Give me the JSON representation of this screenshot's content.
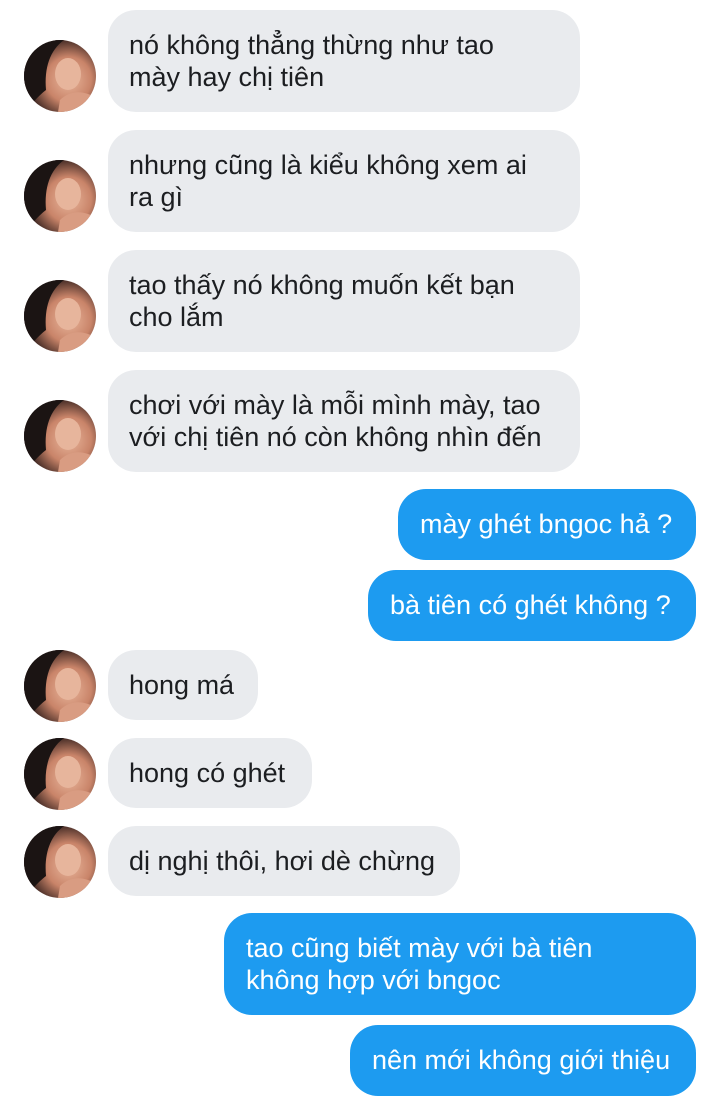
{
  "messages": [
    {
      "direction": "received",
      "text": "nó không thẳng thừng như tao\nmày hay chị tiên"
    },
    {
      "direction": "received",
      "text": "nhưng cũng là kiểu không xem ai\nra gì"
    },
    {
      "direction": "received",
      "text": "tao thấy nó không muốn kết bạn\ncho lắm"
    },
    {
      "direction": "received",
      "text": "chơi với mày là mỗi mình mày, tao\nvới chị tiên nó còn không nhìn đến"
    },
    {
      "direction": "sent",
      "text": "mày ghét bngoc hả ?"
    },
    {
      "direction": "sent",
      "text": "bà tiên có ghét không ?"
    },
    {
      "direction": "received",
      "text": "hong má"
    },
    {
      "direction": "received",
      "text": "hong có ghét"
    },
    {
      "direction": "received",
      "text": "dị nghị thôi, hơi dè chừng"
    },
    {
      "direction": "sent",
      "text": "tao cũng biết mày với bà tiên\nkhông hợp với bngoc"
    },
    {
      "direction": "sent",
      "text": "nên mới không giới thiệu"
    }
  ],
  "colors": {
    "received_bubble": "#e9ebee",
    "received_text": "#1c1e21",
    "sent_bubble": "#1d9bf0",
    "sent_text": "#ffffff"
  },
  "icons": {
    "avatar": "contact-photo"
  }
}
